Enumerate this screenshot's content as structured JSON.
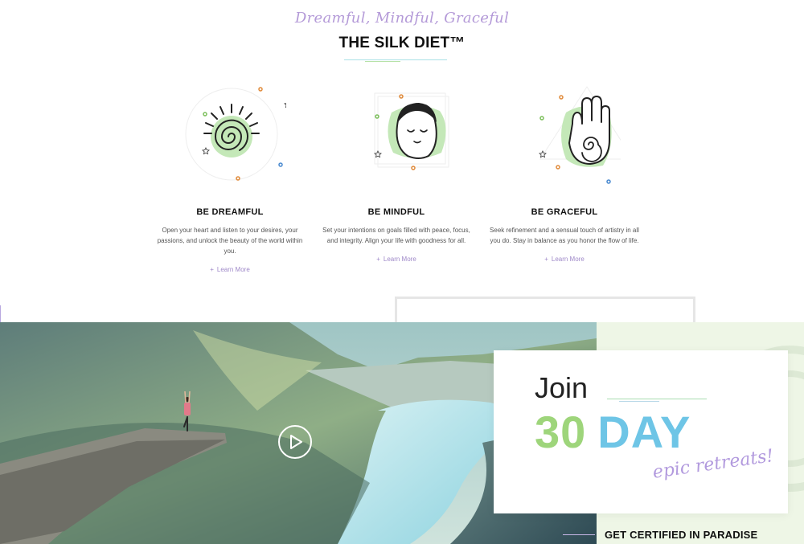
{
  "header": {
    "tagline": "Dreamful, Mindful, Graceful",
    "title": "THE SILK DIET™"
  },
  "features": [
    {
      "icon": "sun-spiral-icon",
      "title": "BE DREAMFUL",
      "text": "Open your heart and listen to your desires, your passions, and unlock the beauty of the world within you.",
      "link": "Learn More"
    },
    {
      "icon": "meditating-face-icon",
      "title": "BE MINDFUL",
      "text": "Set your intentions on goals filled with peace, focus, and integrity. Align your life with goodness for all.",
      "link": "Learn More"
    },
    {
      "icon": "spiral-hand-icon",
      "title": "BE GRACEFUL",
      "text": "Seek refinement and a sensual touch of artistry in all you do. Stay in balance as you honor the flow of life.",
      "link": "Learn More"
    }
  ],
  "promo": {
    "join": "Join",
    "number": "30",
    "unit": "DAY",
    "script": "epic retreats!",
    "footer_heading": "GET CERTIFIED IN PARADISE",
    "play_icon": "play-icon"
  },
  "colors": {
    "accent_purple": "#b49ad8",
    "accent_green": "#9ed57b",
    "accent_blue": "#6ec5e6",
    "panel_green": "#eef6e6"
  }
}
